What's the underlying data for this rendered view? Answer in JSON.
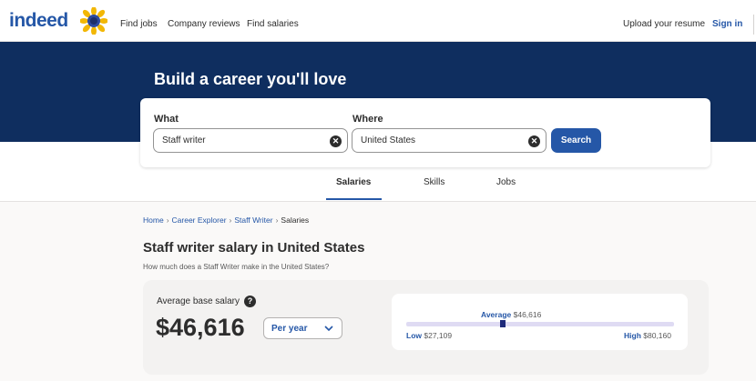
{
  "header": {
    "logo_text": "indeed",
    "nav": [
      "Find jobs",
      "Company reviews",
      "Find salaries"
    ],
    "upload_resume": "Upload your resume",
    "sign_in": "Sign in",
    "colors": {
      "brand": "#2557a7",
      "hero": "#0f2e5f"
    }
  },
  "hero": {
    "title": "Build a career you'll love"
  },
  "search": {
    "what_label": "What",
    "what_value": "Staff writer",
    "where_label": "Where",
    "where_value": "United States",
    "button_label": "Search",
    "clear_glyph": "✕"
  },
  "tabs": [
    {
      "label": "Salaries",
      "active": true
    },
    {
      "label": "Skills",
      "active": false
    },
    {
      "label": "Jobs",
      "active": false
    }
  ],
  "breadcrumb": [
    "Home",
    "Career Explorer",
    "Staff Writer",
    "Salaries"
  ],
  "breadcrumb_sep": "›",
  "page": {
    "title": "Staff writer salary in United States",
    "subtitle": "How much does a Staff Writer make in the United States?"
  },
  "salary": {
    "avg_label": "Average base salary",
    "help_glyph": "?",
    "amount": "$46,616",
    "period": "Per year",
    "range": {
      "avg_label": "Average",
      "avg_value": "$46,616",
      "low_label": "Low",
      "low_value": "$27,109",
      "high_label": "High",
      "high_value": "$80,160",
      "average_position_fraction": 0.36
    }
  }
}
